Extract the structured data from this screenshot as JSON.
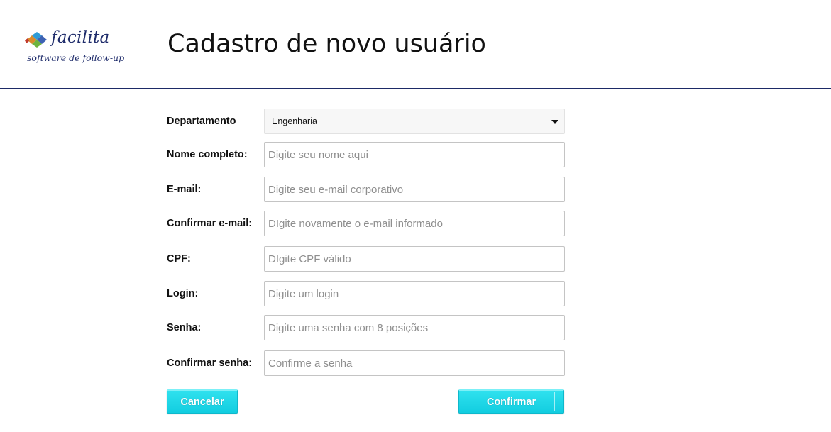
{
  "header": {
    "logo_name": "facilita",
    "logo_tagline": "software de follow-up",
    "title": "Cadastro de novo usuário"
  },
  "form": {
    "department": {
      "label": "Departamento",
      "selected": "Engenharia"
    },
    "fields": [
      {
        "label": "Nome completo:",
        "placeholder": "Digite seu nome aqui"
      },
      {
        "label": "E-mail:",
        "placeholder": "Digite seu e-mail corporativo"
      },
      {
        "label": "Confirmar e-mail:",
        "placeholder": "DIgite novamente o e-mail informado"
      },
      {
        "label": "CPF:",
        "placeholder": "DIgite CPF válido"
      },
      {
        "label": "Login:",
        "placeholder": "Digite um login"
      },
      {
        "label": "Senha:",
        "placeholder": "Digite uma senha com 8 posições"
      },
      {
        "label": "Confirmar senha:",
        "placeholder": "Confirme a senha"
      }
    ]
  },
  "actions": {
    "cancel_label": "Cancelar",
    "confirm_label": "Confirmar"
  },
  "colors": {
    "accent": "#1fd6e6",
    "header_rule": "#1d2a66",
    "brand": "#1f2c6b"
  },
  "icons": {
    "logo": "facilita-logo-icon",
    "select_caret": "caret-down-icon"
  }
}
